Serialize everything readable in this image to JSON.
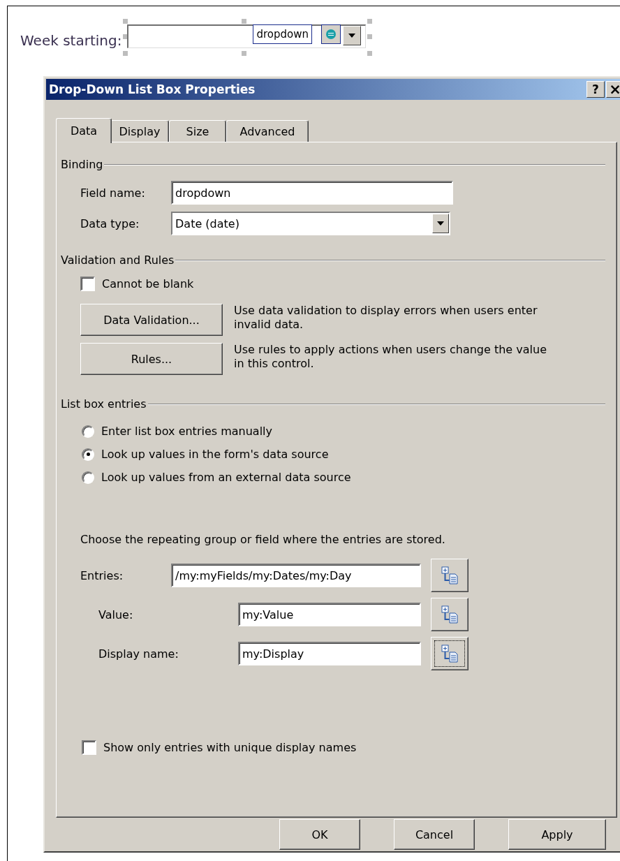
{
  "canvas": {
    "label": "Week starting:",
    "control": {
      "tag": "dropdown"
    }
  },
  "dialog": {
    "title": "Drop-Down List Box Properties",
    "title_buttons": [
      {
        "kind": "help",
        "label": "?"
      },
      {
        "kind": "close",
        "label": "×"
      }
    ],
    "tabs": [
      {
        "label": "Data",
        "selected": true
      },
      {
        "label": "Display",
        "selected": false
      },
      {
        "label": "Size",
        "selected": false
      },
      {
        "label": "Advanced",
        "selected": false
      }
    ],
    "binding": {
      "legend": "Binding",
      "field_name": {
        "label": "Field name:",
        "value": "dropdown"
      },
      "data_type": {
        "label": "Data type:",
        "value": "Date (date)"
      }
    },
    "validation": {
      "legend": "Validation and Rules",
      "cannot_be_blank": {
        "label": "Cannot be blank",
        "checked": false
      },
      "actions": [
        {
          "button": "Data Validation...",
          "description": "Use data validation to display errors when users enter invalid data."
        },
        {
          "button": "Rules...",
          "description": "Use rules to apply actions when users change the value in this control."
        }
      ]
    },
    "list_entries": {
      "legend": "List box entries",
      "options": [
        {
          "label": "Enter list box entries manually",
          "selected": false
        },
        {
          "label": "Look up values in the form's data source",
          "selected": true
        },
        {
          "label": "Look up values from an external data source",
          "selected": false
        }
      ],
      "prompt": "Choose the repeating group or field where the entries are stored.",
      "entries": {
        "label": "Entries:",
        "value": "/my:myFields/my:Dates/my:Day",
        "focused": false,
        "children": [
          {
            "label": "Value:",
            "value": "my:Value",
            "focused": false
          },
          {
            "label": "Display name:",
            "value": "my:Display",
            "focused": true
          }
        ]
      }
    },
    "unique_names": {
      "label": "Show only entries with unique display names",
      "checked": false
    },
    "buttons": [
      "OK",
      "Cancel",
      "Apply"
    ]
  }
}
